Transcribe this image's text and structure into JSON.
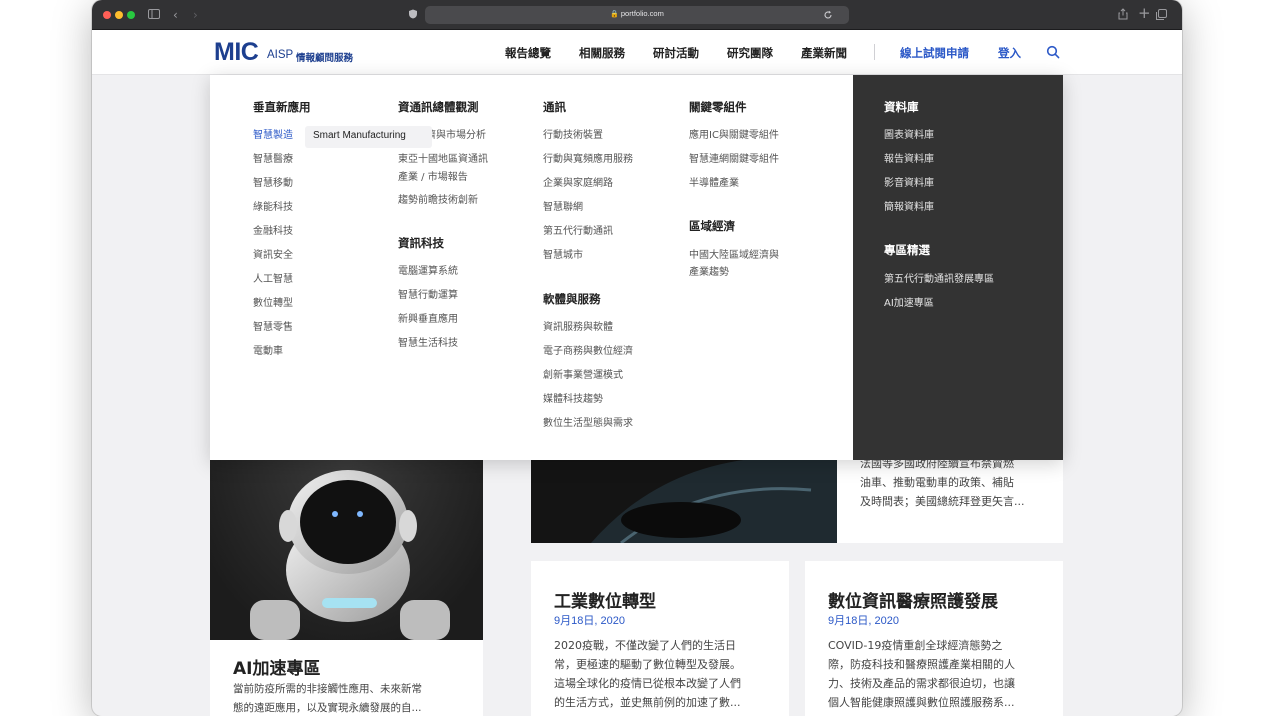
{
  "browser": {
    "url": "portfolio.com",
    "traffic_colors": [
      "#ff5f57",
      "#febc2e",
      "#28c840"
    ]
  },
  "header": {
    "logo_main": "MIC",
    "logo_sub": "AISP",
    "logo_cn": "情報顧問服務",
    "nav": [
      "報告總覽",
      "相關服務",
      "研討活動",
      "研究團隊",
      "產業新聞"
    ],
    "trial_link": "線上試閱申請",
    "login_link": "登入"
  },
  "mega_menu": {
    "col1": {
      "heading": "垂直新應用",
      "items": [
        "智慧製造",
        "智慧醫療",
        "智慧移動",
        "綠能科技",
        "金融科技",
        "資訊安全",
        "人工智慧",
        "數位轉型",
        "智慧零售",
        "電動車"
      ]
    },
    "tooltip": "Smart Manufacturing",
    "col2": {
      "heading1": "資通訊總體觀測",
      "items1": [
        "濟與市場分析",
        "東亞十國地區資通訊",
        "產業 / 市場報告",
        "趨勢前瞻技術創新"
      ],
      "heading2": "資訊科技",
      "items2": [
        "電腦運算系統",
        "智慧行動運算",
        "新興垂直應用",
        "智慧生活科技"
      ]
    },
    "col3": {
      "heading1": "通訊",
      "items1": [
        "行動技術裝置",
        "行動與寬頻應用服務",
        "企業與家庭網路",
        "智慧聯網",
        "第五代行動通訊",
        "智慧城市"
      ],
      "heading2": "軟體與服務",
      "items2": [
        "資訊服務與軟體",
        "電子商務與數位經濟",
        "創新事業營運模式",
        "媒體科技趨勢",
        "數位生活型態與需求"
      ]
    },
    "col4": {
      "heading1": "關鍵零組件",
      "items1": [
        "應用IC與關鍵零組件",
        "智慧連網關鍵零組件",
        "半導體產業"
      ],
      "heading2": "區域經濟",
      "items2": [
        "中國大陸區域經濟與",
        "產業趨勢"
      ]
    },
    "col5": {
      "heading1": "資料庫",
      "items1": [
        "圖表資料庫",
        "報告資料庫",
        "影音資料庫",
        "簡報資料庫"
      ],
      "heading2": "專區精選",
      "items2": [
        "第五代行動通訊發展專區",
        "AI加速專區"
      ]
    }
  },
  "cards": {
    "ev_text": [
      "法國等多國政府陸續宣布禁賣燃",
      "油車、推動電動車的政策、補貼",
      "及時間表；美國總統拜登更矢言..."
    ],
    "ai": {
      "title": "AI加速專區",
      "text": [
        "當前防疫所需的非接觸性應用、未來新常",
        "態的遠距應用，以及實現永續發展的自..."
      ]
    },
    "industry": {
      "title": "工業數位轉型",
      "date": "9月18日, 2020",
      "text": [
        "2020疫戰，不僅改變了人們的生活日",
        "常，更極速的驅動了數位轉型及發展。",
        "這場全球化的疫情已從根本改變了人們",
        "的生活方式，並史無前例的加速了數..."
      ]
    },
    "health": {
      "title": "數位資訊醫療照護發展",
      "date": "9月18日, 2020",
      "text": [
        "COVID-19疫情重創全球經濟態勢之",
        "際，防疫科技和醫療照護產業相關的人",
        "力、技術及產品的需求都很迫切，也讓",
        "個人智能健康照護與數位照護服務系..."
      ]
    }
  }
}
